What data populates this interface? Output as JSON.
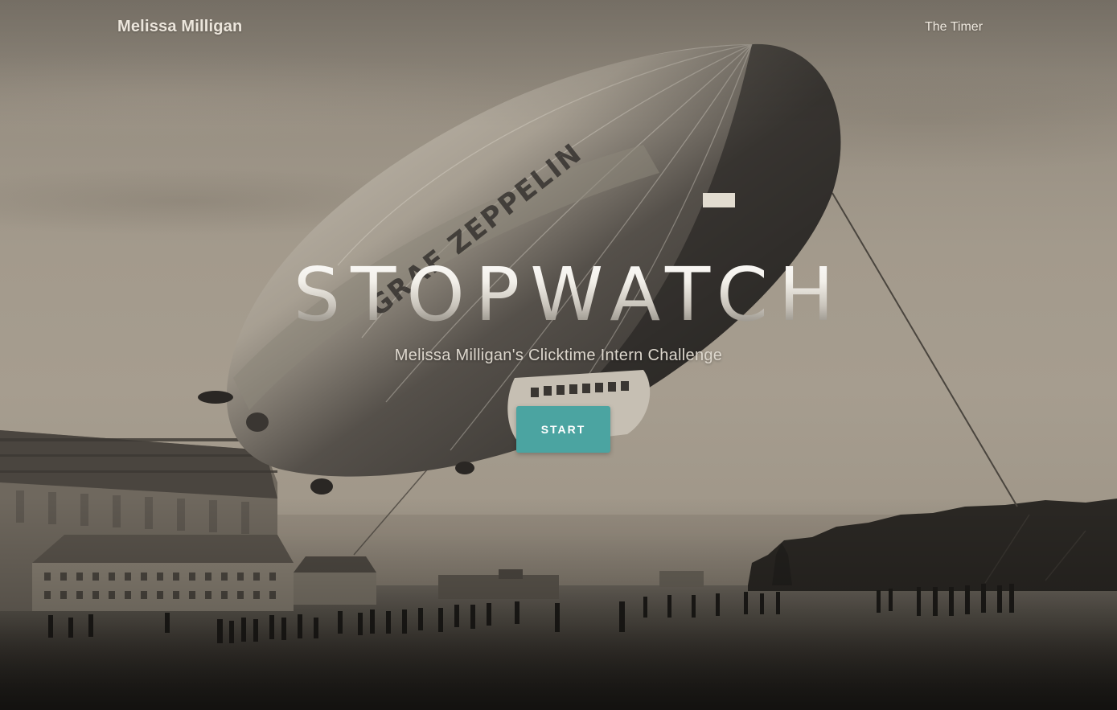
{
  "nav": {
    "brand": "Melissa Milligan",
    "link": "The Timer"
  },
  "hero": {
    "title": "STOPWATCH",
    "subtitle": "Melissa Milligan's Clicktime Intern Challenge",
    "start_label": "START"
  },
  "colors": {
    "button_bg": "#4ba4a1",
    "button_text": "#ffffff",
    "photo_tone": "#a39a8c"
  },
  "icons": {
    "hero_image": "zeppelin-photo"
  }
}
